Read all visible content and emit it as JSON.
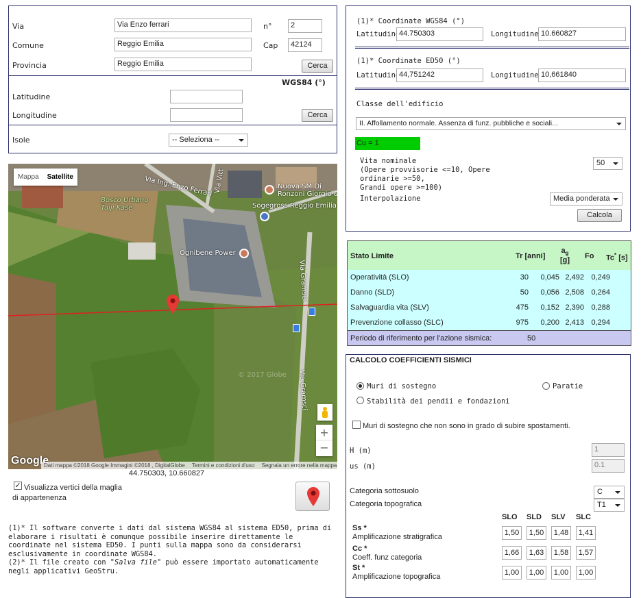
{
  "address": {
    "via_label": "Via",
    "via_value": "Via Enzo ferrari",
    "num_label": "n°",
    "num_value": "2",
    "comune_label": "Comune",
    "comune_value": "Reggio Emilia",
    "cap_label": "Cap",
    "cap_value": "42124",
    "provincia_label": "Provincia",
    "provincia_value": "Reggio Emilia",
    "cerca_label": "Cerca"
  },
  "wgs_input": {
    "heading": "WGS84 (°)",
    "lat_label": "Latitudine",
    "lat_value": "",
    "lon_label": "Longitudine",
    "lon_value": "",
    "cerca_label": "Cerca"
  },
  "isole": {
    "label": "Isole",
    "value": "-- Seleziona --"
  },
  "map": {
    "mappa": "Mappa",
    "satellite": "Satellite",
    "places": [
      "Via Ing. Enzo Ferrari",
      "Via Vitt",
      "Nuova SM Di Ronzoni Giorgio &",
      "Sogegross Reggio Emilia",
      "Bosco Urbano Taiji Kase",
      "Ognibene Power",
      "Via Gramsci",
      "Via Gramsci"
    ],
    "watermark": "© 2017 Globe",
    "google": "Google",
    "footer_a": "Dati mappa ©2018 Google Immagini ©2018 , DigitalGlobe",
    "footer_b": "Termini e condizioni d'uso",
    "footer_c": "Segnala un errore nella mappa",
    "coords": "44.750303, 10.660827",
    "zoom_in": "+",
    "zoom_out": "−"
  },
  "vertici": {
    "label_1": "Visualizza vertici della maglia",
    "label_2": "di appartenenza"
  },
  "notes": {
    "n1": "(1)* Il software converte i dati dal sistema WGS84 al sistema ED50, prima di elaborare i risultati è comunque possibile inserire direttamente le coordinate nel sistema ED50. I punti sulla mappa sono da considerarsi esclusivamente in coordinate WGS84.",
    "n2_a": "(2)* Il file creato con ",
    "n2_b": "\"Salva file\"",
    "n2_c": " può essere importato automaticamente negli applicativi GeoStru."
  },
  "coords_wgs": {
    "title": "(1)* Coordinate WGS84 (°)",
    "lat_label": "Latitudine",
    "lat_value": "44.750303",
    "lon_label": "Longitudine",
    "lon_value": "10.660827"
  },
  "coords_ed50": {
    "title": "(1)* Coordinate ED50 (°)",
    "lat_label": "Latitudine",
    "lat_value": "44,751242",
    "lon_label": "Longitudine",
    "lon_value": "10,661840"
  },
  "classe": {
    "label": "Classe dell'edificio",
    "value": "II. Affollamento normale. Assenza di funz. pubbliche e sociali...",
    "cu": "Cu = 1",
    "vita_1": "Vita nominale",
    "vita_2": "(Opere provvisorie <=10, Opere",
    "vita_3": "ordinarie >=50,",
    "vita_4": "Grandi opere >=100)",
    "vita_value": "50",
    "interp_label": "Interpolazione",
    "interp_value": "Media ponderata",
    "calcola": "Calcola"
  },
  "stato": {
    "headers": [
      "Stato Limite",
      "Tr [anni]",
      "a",
      "g",
      "[g]",
      "Fo",
      "Tc",
      "*",
      " [s]"
    ],
    "rows": [
      [
        "Operatività (SLO)",
        "30",
        "0,045",
        "2,492",
        "0,249"
      ],
      [
        "Danno (SLD)",
        "50",
        "0,056",
        "2,508",
        "0,264"
      ],
      [
        "Salvaguardia vita (SLV)",
        "475",
        "0,152",
        "2,390",
        "0,288"
      ],
      [
        "Prevenzione collasso (SLC)",
        "975",
        "0,200",
        "2,413",
        "0,294"
      ]
    ],
    "periodo_label": "Periodo di riferimento per l'azione sismica:",
    "periodo_value": "50"
  },
  "coeff": {
    "title": "CALCOLO COEFFICIENTI SISMICI",
    "r1": "Muri di sostegno",
    "r2": "Paratie",
    "r3": "Stabilità dei pendii e fondazioni",
    "chk": "Muri di sostegno che non sono in grado di subire spostamenti.",
    "h_label": "H (m)",
    "h_value": "1",
    "us_label": "us (m)",
    "us_value": "0.1",
    "cat_sotto_label": "Categoria sottosuolo",
    "cat_sotto_value": "C",
    "cat_topo_label": "Categoria topografica",
    "cat_topo_value": "T1",
    "cols": [
      "SLO",
      "SLD",
      "SLV",
      "SLC"
    ],
    "ss_name": "Ss *",
    "ss_desc": "Amplificazione stratigrafica",
    "ss": [
      "1,50",
      "1,50",
      "1,48",
      "1,41"
    ],
    "cc_name": "Cc *",
    "cc_desc": "Coeff. funz categoria",
    "cc": [
      "1,66",
      "1,63",
      "1,58",
      "1,57"
    ],
    "st_name": "St *",
    "st_desc": "Amplificazione topografica",
    "st": [
      "1,00",
      "1,00",
      "1,00",
      "1,00"
    ]
  },
  "colors": {
    "border": "#2a2f6e",
    "green": "#00cc00",
    "table_header": "#c6f5c6",
    "table_row": "#ccffff",
    "table_footer": "#c8c8f0"
  }
}
